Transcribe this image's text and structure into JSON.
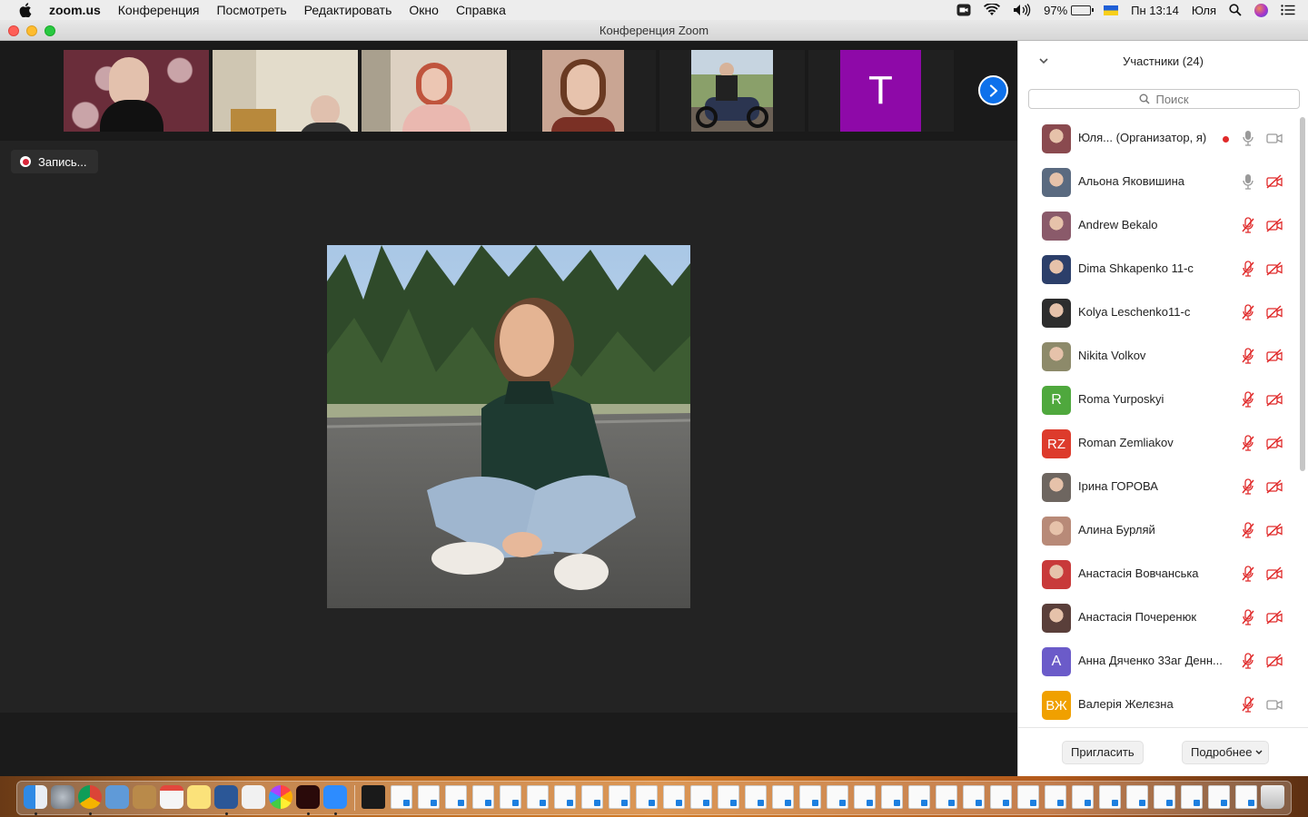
{
  "menubar": {
    "app_name": "zoom.us",
    "items": [
      "Конференция",
      "Посмотреть",
      "Редактировать",
      "Окно",
      "Справка"
    ],
    "battery": "97%",
    "clock": "Пн 13:14",
    "user": "Юля"
  },
  "window": {
    "title": "Конференция Zoom"
  },
  "video": {
    "recording_label": "Запись...",
    "thumbnails": [
      {
        "kind": "photo",
        "colors": [
          "#6a2d3a",
          "#c9a4a8"
        ]
      },
      {
        "kind": "photo",
        "colors": [
          "#b5aa91",
          "#e3dccb"
        ]
      },
      {
        "kind": "photo",
        "colors": [
          "#c7b9a6",
          "#e8d5cc"
        ]
      },
      {
        "kind": "photo",
        "colors": [
          "#8e5a3f",
          "#e7c3ad"
        ]
      },
      {
        "kind": "photo",
        "colors": [
          "#8aa06a",
          "#2b3550"
        ]
      },
      {
        "kind": "letter",
        "letter": "T",
        "color": "#8e09a8"
      }
    ]
  },
  "panel": {
    "title": "Участники (24)",
    "search_placeholder": "Поиск",
    "participants": [
      {
        "name": "Юля...   (Организатор, я)",
        "avatar": "photo",
        "color": "#8a4a4f",
        "mic": "on",
        "cam": "on",
        "host": true
      },
      {
        "name": "Альона Яковишина",
        "avatar": "photo",
        "color": "#5a6a80",
        "mic": "on",
        "cam": "off"
      },
      {
        "name": "Andrew Bekalo",
        "avatar": "photo",
        "color": "#8a5a6a",
        "mic": "off",
        "cam": "off"
      },
      {
        "name": "Dima Shkapenko 11-c",
        "avatar": "photo",
        "color": "#2c3f6a",
        "mic": "off",
        "cam": "off"
      },
      {
        "name": "Kolya Leschenko11-c",
        "avatar": "photo",
        "color": "#2d2d2d",
        "mic": "off",
        "cam": "off"
      },
      {
        "name": "Nikita Volkov",
        "avatar": "photo",
        "color": "#8d8a6a",
        "mic": "off",
        "cam": "off"
      },
      {
        "name": "Roma Yurposkyi",
        "avatar": "letter",
        "letter": "R",
        "color": "#4fa83d",
        "mic": "off",
        "cam": "off"
      },
      {
        "name": "Roman Zemliakov",
        "avatar": "letter",
        "letter": "RZ",
        "color": "#dd3b2c",
        "mic": "off",
        "cam": "off"
      },
      {
        "name": "Ірина ГОРОВА",
        "avatar": "photo",
        "color": "#6e6660",
        "mic": "off",
        "cam": "off"
      },
      {
        "name": "Алина Бурляй",
        "avatar": "photo",
        "color": "#b88a78",
        "mic": "off",
        "cam": "off"
      },
      {
        "name": "Анастасія Вовчанська",
        "avatar": "photo",
        "color": "#c83a3a",
        "mic": "off",
        "cam": "off"
      },
      {
        "name": "Анастасія Почеренюк",
        "avatar": "photo",
        "color": "#5a3f3a",
        "mic": "off",
        "cam": "off"
      },
      {
        "name": "Анна Дяченко 33аг Денн...",
        "avatar": "letter",
        "letter": "A",
        "color": "#6b5bc9",
        "mic": "off",
        "cam": "off"
      },
      {
        "name": "Валерія Желєзна",
        "avatar": "letter",
        "letter": "ВЖ",
        "color": "#f0a000",
        "mic": "off",
        "cam": "on"
      }
    ],
    "invite_label": "Пригласить",
    "more_label": "Подробнее"
  },
  "colors": {
    "accent": "#0e71eb",
    "muted_red": "#e02a2a",
    "recording": "#d9263a"
  }
}
